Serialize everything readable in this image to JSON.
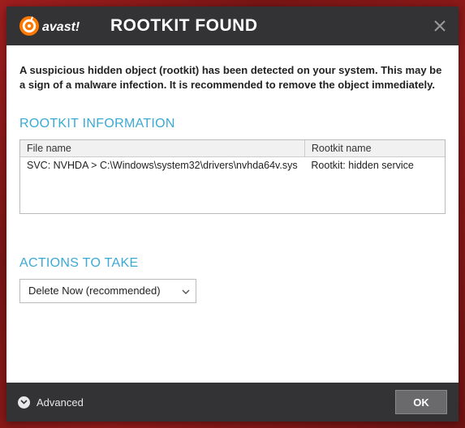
{
  "header": {
    "brand_text": "avast!",
    "title": "ROOTKIT FOUND"
  },
  "warning_text": "A suspicious hidden object (rootkit) has been detected on your system. This may be a sign of a malware infection. It is recommended to remove the object immediately.",
  "sections": {
    "rootkit_info": {
      "title": "ROOTKIT INFORMATION",
      "columns": {
        "file_name": "File name",
        "rootkit_name": "Rootkit name"
      },
      "rows": [
        {
          "file_name": "SVC: NVHDA > C:\\Windows\\system32\\drivers\\nvhda64v.sys",
          "rootkit_name": "Rootkit: hidden service"
        }
      ]
    },
    "actions": {
      "title": "ACTIONS TO TAKE",
      "selected": "Delete Now (recommended)"
    }
  },
  "footer": {
    "advanced_label": "Advanced",
    "ok_label": "OK"
  },
  "colors": {
    "accent": "#3aa9d4",
    "header_bg": "#333335",
    "brand_orange": "#ff7800"
  }
}
